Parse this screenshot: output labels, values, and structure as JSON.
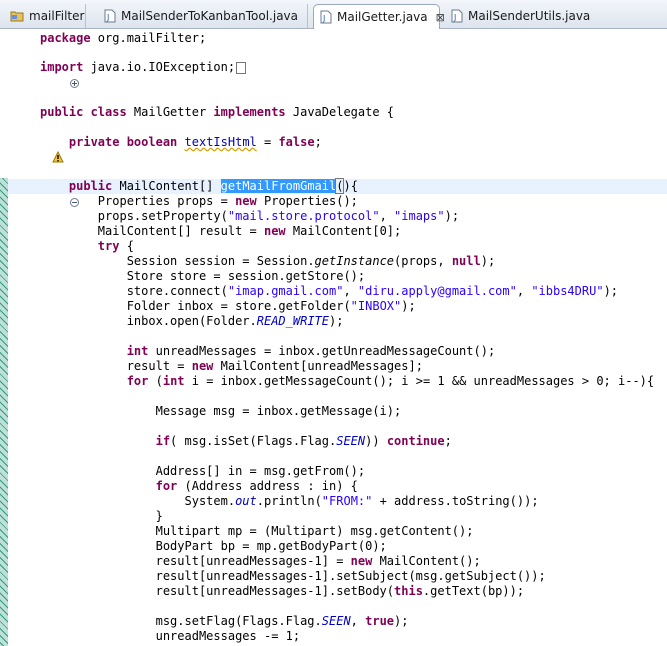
{
  "tabs": [
    {
      "label": "mailFilter",
      "active": false
    },
    {
      "label": "MailSenderToKanbanTool.java",
      "active": false
    },
    {
      "label": "MailGetter.java",
      "active": true
    },
    {
      "label": "MailSenderUtils.java",
      "active": false
    }
  ],
  "close_glyph": "⊠",
  "code": {
    "l_package_kw": "package",
    "l_package_rest": " org.mailFilter;",
    "l_import_kw": "import",
    "l_import_rest": " java.io.IOException;",
    "l_class_kw1": "public class",
    "l_class_name": " MailGetter ",
    "l_class_kw2": "implements",
    "l_class_rest": " JavaDelegate {",
    "l_field_kw": "private boolean",
    "l_field_name": "textIsHtml",
    "l_field_eq": " = ",
    "l_field_false": "false",
    "l_field_end": ";",
    "l_method_kw": "public",
    "l_method_type": " MailContent[] ",
    "l_method_name": "getMailFromGmail",
    "l_method_paren": "(",
    "l_method_end": "){",
    "l_props_a": "Properties props = ",
    "l_props_new": "new",
    "l_props_b": " Properties();",
    "l_setprop_a": "props.setProperty(",
    "l_setprop_s1": "\"mail.store.protocol\"",
    "l_setprop_b": ", ",
    "l_setprop_s2": "\"imaps\"",
    "l_setprop_c": ");",
    "l_result_a": "MailContent[] result = ",
    "l_result_new": "new",
    "l_result_b": " MailContent[0];",
    "l_try_kw": "try",
    "l_try_b": " {",
    "l_session_a": "Session session = Session.",
    "l_session_m": "getInstance",
    "l_session_b": "(props, ",
    "l_session_null": "null",
    "l_session_c": ");",
    "l_store": "Store store = session.getStore();",
    "l_connect_a": "store.connect(",
    "l_connect_s1": "\"imap.gmail.com\"",
    "l_connect_b": ", ",
    "l_connect_s2": "\"diru.apply@gmail.com\"",
    "l_connect_c": ", ",
    "l_connect_s3": "\"ibbs4DRU\"",
    "l_connect_d": ");",
    "l_folder_a": "Folder inbox = store.getFolder(",
    "l_folder_s": "\"INBOX\"",
    "l_folder_b": ");",
    "l_open_a": "inbox.open(Folder.",
    "l_open_f": "READ_WRITE",
    "l_open_b": ");",
    "l_unread_kw": "int",
    "l_unread_b": " unreadMessages = inbox.getUnreadMessageCount();",
    "l_res2_a": "result = ",
    "l_res2_new": "new",
    "l_res2_b": " MailContent[unreadMessages];",
    "l_for_kw": "for",
    "l_for_b": " (",
    "l_for_int": "int",
    "l_for_c": " i = inbox.getMessageCount(); i >= 1 && unreadMessages > 0; i--){",
    "l_msg": "Message msg = inbox.getMessage(i);",
    "l_if_kw": "if",
    "l_if_b": "( msg.isSet(Flags.Flag.",
    "l_if_f": "SEEN",
    "l_if_c": ")) ",
    "l_if_cont": "continue",
    "l_if_d": ";",
    "l_addr": "Address[] in = msg.getFrom();",
    "l_for2_kw": "for",
    "l_for2_b": " (Address address : in) {",
    "l_print_a": "System.",
    "l_print_out": "out",
    "l_print_b": ".println(",
    "l_print_s": "\"FROM:\"",
    "l_print_c": " + address.toString());",
    "l_close": "}",
    "l_mp": "Multipart mp = (Multipart) msg.getContent();",
    "l_bp": "BodyPart bp = mp.getBodyPart(0);",
    "l_r1_a": "result[unreadMessages-1] = ",
    "l_r1_new": "new",
    "l_r1_b": " MailContent();",
    "l_r2": "result[unreadMessages-1].setSubject(msg.getSubject());",
    "l_r3_a": "result[unreadMessages-1].setBody(",
    "l_r3_this": "this",
    "l_r3_b": ".getText(bp));",
    "l_flag_a": "msg.setFlag(Flags.Flag.",
    "l_flag_f": "SEEN",
    "l_flag_b": ", ",
    "l_flag_true": "true",
    "l_flag_c": ");",
    "l_dec": "unreadMessages -= 1;"
  }
}
